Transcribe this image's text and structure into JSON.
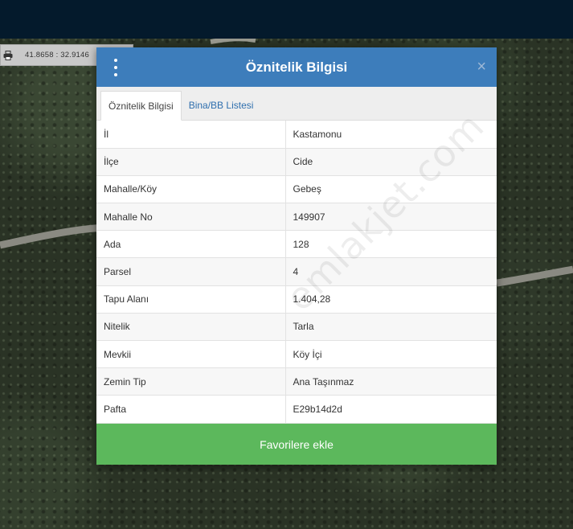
{
  "map": {
    "coordinates": "41.8658 : 32.9146"
  },
  "modal": {
    "title": "Öznitelik Bilgisi",
    "tabs": [
      {
        "label": "Öznitelik Bilgisi",
        "active": true
      },
      {
        "label": "Bina/BB Listesi",
        "active": false
      }
    ],
    "rows": [
      {
        "key": "İl",
        "value": "Kastamonu"
      },
      {
        "key": "İlçe",
        "value": "Cide"
      },
      {
        "key": "Mahalle/Köy",
        "value": "Gebeş"
      },
      {
        "key": "Mahalle No",
        "value": "149907"
      },
      {
        "key": "Ada",
        "value": "128"
      },
      {
        "key": "Parsel",
        "value": "4"
      },
      {
        "key": "Tapu Alanı",
        "value": "1.404,28"
      },
      {
        "key": "Nitelik",
        "value": "Tarla"
      },
      {
        "key": "Mevkii",
        "value": "Köy İçi"
      },
      {
        "key": "Zemin Tip",
        "value": "Ana Taşınmaz"
      },
      {
        "key": "Pafta",
        "value": "E29b14d2d"
      }
    ],
    "favorite_button": "Favorilere ekle",
    "close_symbol": "×"
  },
  "watermark": "emlakjet.com",
  "icons": {
    "menu": "kebab-menu-icon",
    "close": "close-icon",
    "print": "printer-icon"
  },
  "colors": {
    "header": "#3d7dbb",
    "favorite_button": "#5cb85c",
    "topbar": "#041a2c",
    "tab_link": "#2f6fae"
  }
}
